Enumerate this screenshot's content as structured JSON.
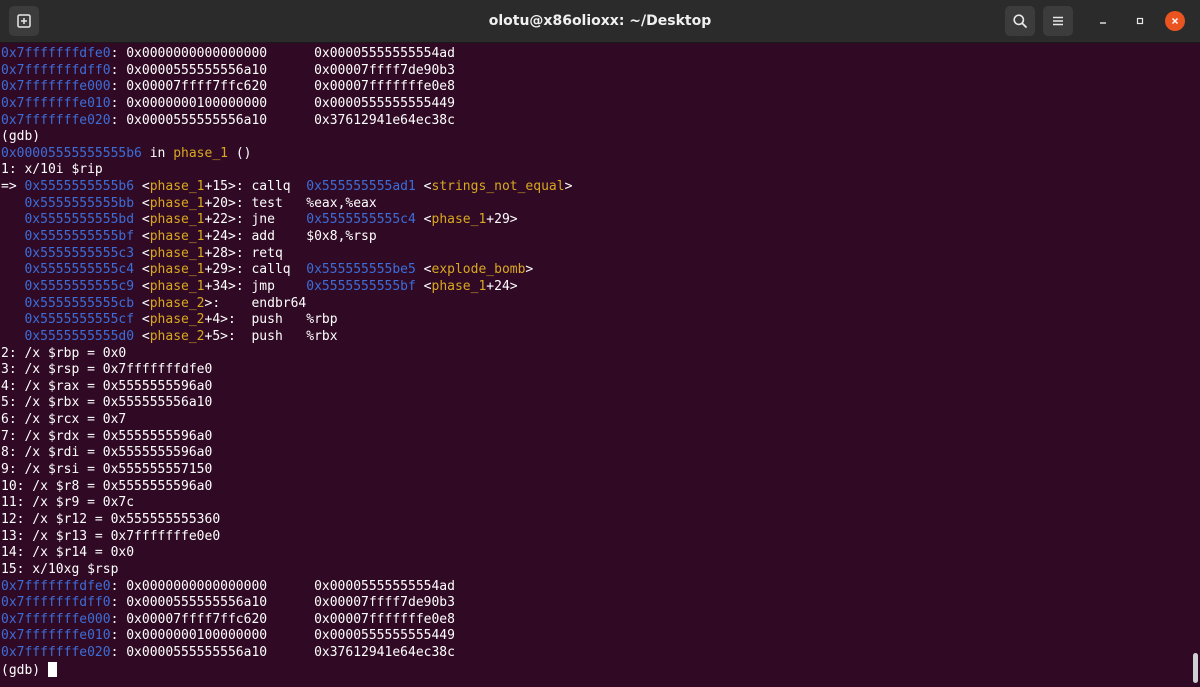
{
  "window": {
    "title": "olotu@x86olioxx: ~/Desktop"
  },
  "colors": {
    "background": "#300a24",
    "address": "#3d6dd9",
    "function": "#d8a821",
    "text": "#ffffff",
    "close_button": "#e95420"
  },
  "icons": {
    "new_tab": "new-tab-icon",
    "search": "search-icon",
    "menu": "hamburger-menu-icon",
    "minimize": "minimize-icon",
    "maximize": "maximize-icon",
    "close": "close-icon"
  },
  "terminal": {
    "lines": [
      [
        {
          "t": "0x7fffffffdfe0",
          "c": "addr"
        },
        {
          "t": ": 0x0000000000000000      0x00005555555554ad",
          "c": "text"
        }
      ],
      [
        {
          "t": "0x7fffffffdff0",
          "c": "addr"
        },
        {
          "t": ": 0x0000555555556a10      0x00007ffff7de90b3",
          "c": "text"
        }
      ],
      [
        {
          "t": "0x7fffffffe000",
          "c": "addr"
        },
        {
          "t": ": 0x00007ffff7ffc620      0x00007fffffffe0e8",
          "c": "text"
        }
      ],
      [
        {
          "t": "0x7fffffffe010",
          "c": "addr"
        },
        {
          "t": ": 0x0000000100000000      0x0000555555555449",
          "c": "text"
        }
      ],
      [
        {
          "t": "0x7fffffffe020",
          "c": "addr"
        },
        {
          "t": ": 0x0000555555556a10      0x37612941e64ec38c",
          "c": "text"
        }
      ],
      [
        {
          "t": "(gdb)",
          "c": "text"
        }
      ],
      [
        {
          "t": "0x00005555555555b6",
          "c": "addr"
        },
        {
          "t": " in ",
          "c": "text"
        },
        {
          "t": "phase_1",
          "c": "fn"
        },
        {
          "t": " ()",
          "c": "text"
        }
      ],
      [
        {
          "t": "1: x/10i $rip",
          "c": "text"
        }
      ],
      [
        {
          "t": "=> ",
          "c": "text"
        },
        {
          "t": "0x5555555555b6",
          "c": "addr"
        },
        {
          "t": " <",
          "c": "text"
        },
        {
          "t": "phase_1",
          "c": "fn"
        },
        {
          "t": "+15>: callq  ",
          "c": "text"
        },
        {
          "t": "0x555555555ad1",
          "c": "addr"
        },
        {
          "t": " <",
          "c": "text"
        },
        {
          "t": "strings_not_equal",
          "c": "fn"
        },
        {
          "t": ">",
          "c": "text"
        }
      ],
      [
        {
          "t": "   ",
          "c": "text"
        },
        {
          "t": "0x5555555555bb",
          "c": "addr"
        },
        {
          "t": " <",
          "c": "text"
        },
        {
          "t": "phase_1",
          "c": "fn"
        },
        {
          "t": "+20>: test   %eax,%eax",
          "c": "text"
        }
      ],
      [
        {
          "t": "   ",
          "c": "text"
        },
        {
          "t": "0x5555555555bd",
          "c": "addr"
        },
        {
          "t": " <",
          "c": "text"
        },
        {
          "t": "phase_1",
          "c": "fn"
        },
        {
          "t": "+22>: jne    ",
          "c": "text"
        },
        {
          "t": "0x5555555555c4",
          "c": "addr"
        },
        {
          "t": " <",
          "c": "text"
        },
        {
          "t": "phase_1",
          "c": "fn"
        },
        {
          "t": "+29>",
          "c": "text"
        }
      ],
      [
        {
          "t": "   ",
          "c": "text"
        },
        {
          "t": "0x5555555555bf",
          "c": "addr"
        },
        {
          "t": " <",
          "c": "text"
        },
        {
          "t": "phase_1",
          "c": "fn"
        },
        {
          "t": "+24>: add    $0x8,%rsp",
          "c": "text"
        }
      ],
      [
        {
          "t": "   ",
          "c": "text"
        },
        {
          "t": "0x5555555555c3",
          "c": "addr"
        },
        {
          "t": " <",
          "c": "text"
        },
        {
          "t": "phase_1",
          "c": "fn"
        },
        {
          "t": "+28>: retq",
          "c": "text"
        }
      ],
      [
        {
          "t": "   ",
          "c": "text"
        },
        {
          "t": "0x5555555555c4",
          "c": "addr"
        },
        {
          "t": " <",
          "c": "text"
        },
        {
          "t": "phase_1",
          "c": "fn"
        },
        {
          "t": "+29>: callq  ",
          "c": "text"
        },
        {
          "t": "0x555555555be5",
          "c": "addr"
        },
        {
          "t": " <",
          "c": "text"
        },
        {
          "t": "explode_bomb",
          "c": "fn"
        },
        {
          "t": ">",
          "c": "text"
        }
      ],
      [
        {
          "t": "   ",
          "c": "text"
        },
        {
          "t": "0x5555555555c9",
          "c": "addr"
        },
        {
          "t": " <",
          "c": "text"
        },
        {
          "t": "phase_1",
          "c": "fn"
        },
        {
          "t": "+34>: jmp    ",
          "c": "text"
        },
        {
          "t": "0x5555555555bf",
          "c": "addr"
        },
        {
          "t": " <",
          "c": "text"
        },
        {
          "t": "phase_1",
          "c": "fn"
        },
        {
          "t": "+24>",
          "c": "text"
        }
      ],
      [
        {
          "t": "   ",
          "c": "text"
        },
        {
          "t": "0x5555555555cb",
          "c": "addr"
        },
        {
          "t": " <",
          "c": "text"
        },
        {
          "t": "phase_2",
          "c": "fn"
        },
        {
          "t": ">:    endbr64",
          "c": "text"
        }
      ],
      [
        {
          "t": "   ",
          "c": "text"
        },
        {
          "t": "0x5555555555cf",
          "c": "addr"
        },
        {
          "t": " <",
          "c": "text"
        },
        {
          "t": "phase_2",
          "c": "fn"
        },
        {
          "t": "+4>:  push   %rbp",
          "c": "text"
        }
      ],
      [
        {
          "t": "   ",
          "c": "text"
        },
        {
          "t": "0x5555555555d0",
          "c": "addr"
        },
        {
          "t": " <",
          "c": "text"
        },
        {
          "t": "phase_2",
          "c": "fn"
        },
        {
          "t": "+5>:  push   %rbx",
          "c": "text"
        }
      ],
      [
        {
          "t": "2: /x $rbp = 0x0",
          "c": "text"
        }
      ],
      [
        {
          "t": "3: /x $rsp = 0x7fffffffdfe0",
          "c": "text"
        }
      ],
      [
        {
          "t": "4: /x $rax = 0x5555555596a0",
          "c": "text"
        }
      ],
      [
        {
          "t": "5: /x $rbx = 0x555555556a10",
          "c": "text"
        }
      ],
      [
        {
          "t": "6: /x $rcx = 0x7",
          "c": "text"
        }
      ],
      [
        {
          "t": "7: /x $rdx = 0x5555555596a0",
          "c": "text"
        }
      ],
      [
        {
          "t": "8: /x $rdi = 0x5555555596a0",
          "c": "text"
        }
      ],
      [
        {
          "t": "9: /x $rsi = 0x555555557150",
          "c": "text"
        }
      ],
      [
        {
          "t": "10: /x $r8 = 0x5555555596a0",
          "c": "text"
        }
      ],
      [
        {
          "t": "11: /x $r9 = 0x7c",
          "c": "text"
        }
      ],
      [
        {
          "t": "12: /x $r12 = 0x555555555360",
          "c": "text"
        }
      ],
      [
        {
          "t": "13: /x $r13 = 0x7fffffffe0e0",
          "c": "text"
        }
      ],
      [
        {
          "t": "14: /x $r14 = 0x0",
          "c": "text"
        }
      ],
      [
        {
          "t": "15: x/10xg $rsp",
          "c": "text"
        }
      ],
      [
        {
          "t": "0x7fffffffdfe0",
          "c": "addr"
        },
        {
          "t": ": 0x0000000000000000      0x00005555555554ad",
          "c": "text"
        }
      ],
      [
        {
          "t": "0x7fffffffdff0",
          "c": "addr"
        },
        {
          "t": ": 0x0000555555556a10      0x00007ffff7de90b3",
          "c": "text"
        }
      ],
      [
        {
          "t": "0x7fffffffe000",
          "c": "addr"
        },
        {
          "t": ": 0x00007ffff7ffc620      0x00007fffffffe0e8",
          "c": "text"
        }
      ],
      [
        {
          "t": "0x7fffffffe010",
          "c": "addr"
        },
        {
          "t": ": 0x0000000100000000      0x0000555555555449",
          "c": "text"
        }
      ],
      [
        {
          "t": "0x7fffffffe020",
          "c": "addr"
        },
        {
          "t": ": 0x0000555555556a10      0x37612941e64ec38c",
          "c": "text"
        }
      ]
    ],
    "prompt": "(gdb) "
  }
}
